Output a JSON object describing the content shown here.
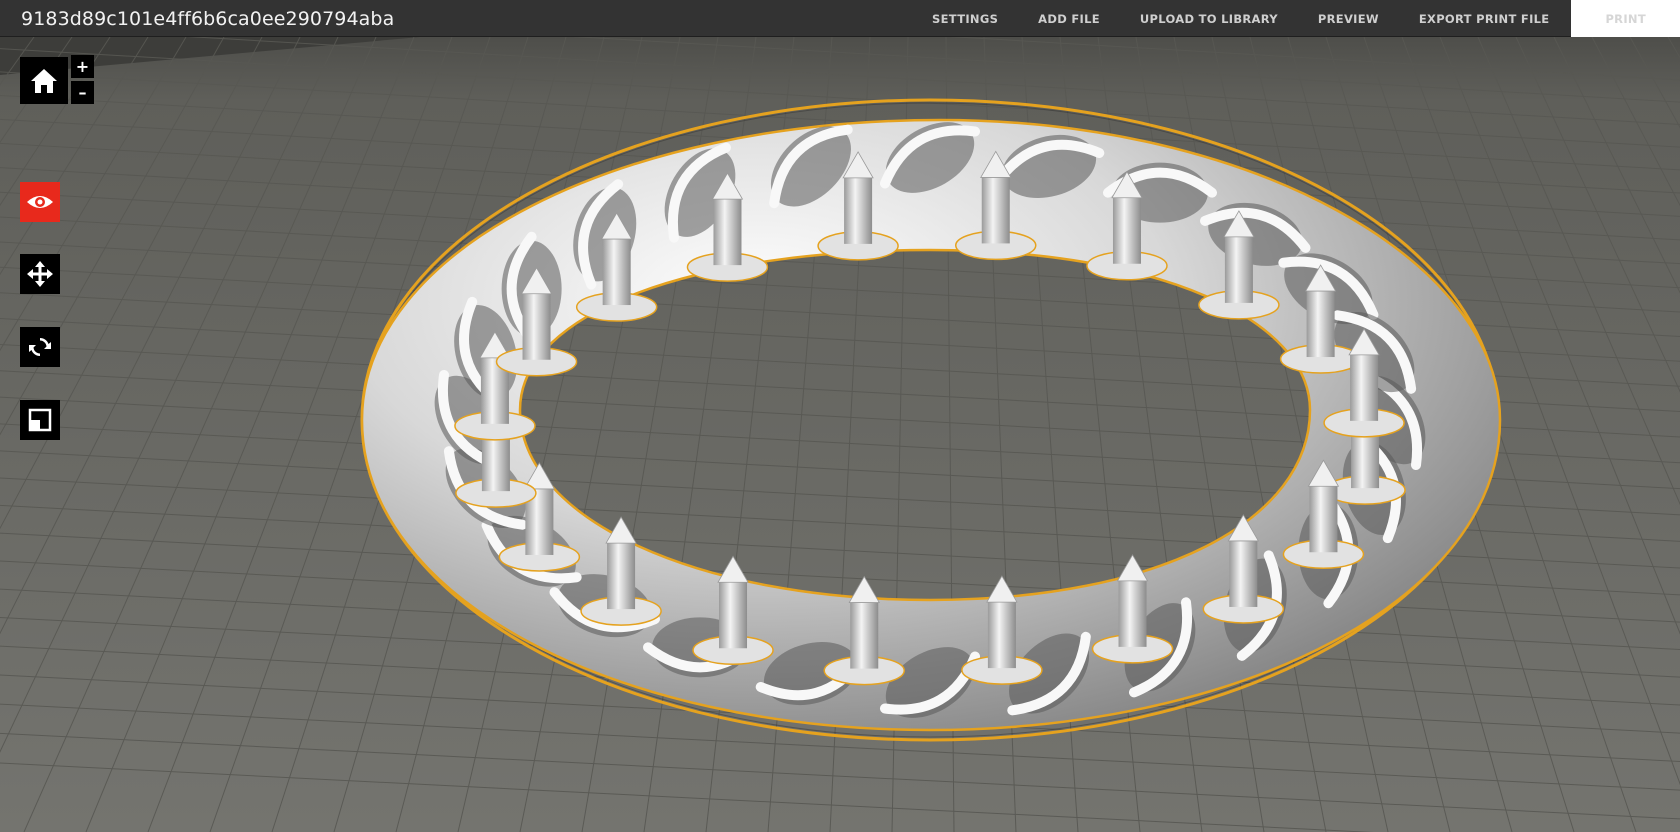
{
  "header": {
    "file_name": "9183d89c101e4ff6b6ca0ee290794aba",
    "nav": {
      "settings": "SETTINGS",
      "add_file": "ADD FILE",
      "upload_to_library": "UPLOAD TO LIBRARY",
      "preview": "PREVIEW",
      "export_print_file": "EXPORT PRINT FILE",
      "print": "PRINT"
    }
  },
  "toolbar": {
    "zoom_in": "+",
    "zoom_out": "–",
    "icons": [
      "home-icon",
      "eye-icon",
      "move-icon",
      "rotate-icon",
      "scale-icon"
    ],
    "active_tool": "view"
  },
  "colors": {
    "topbar": "#333333",
    "build_plate": "#6b6b66",
    "grid_line": "#55554f",
    "active_tool": "#e8291c",
    "model_outline": "#e5a21f",
    "model": "#d9d9d9"
  }
}
